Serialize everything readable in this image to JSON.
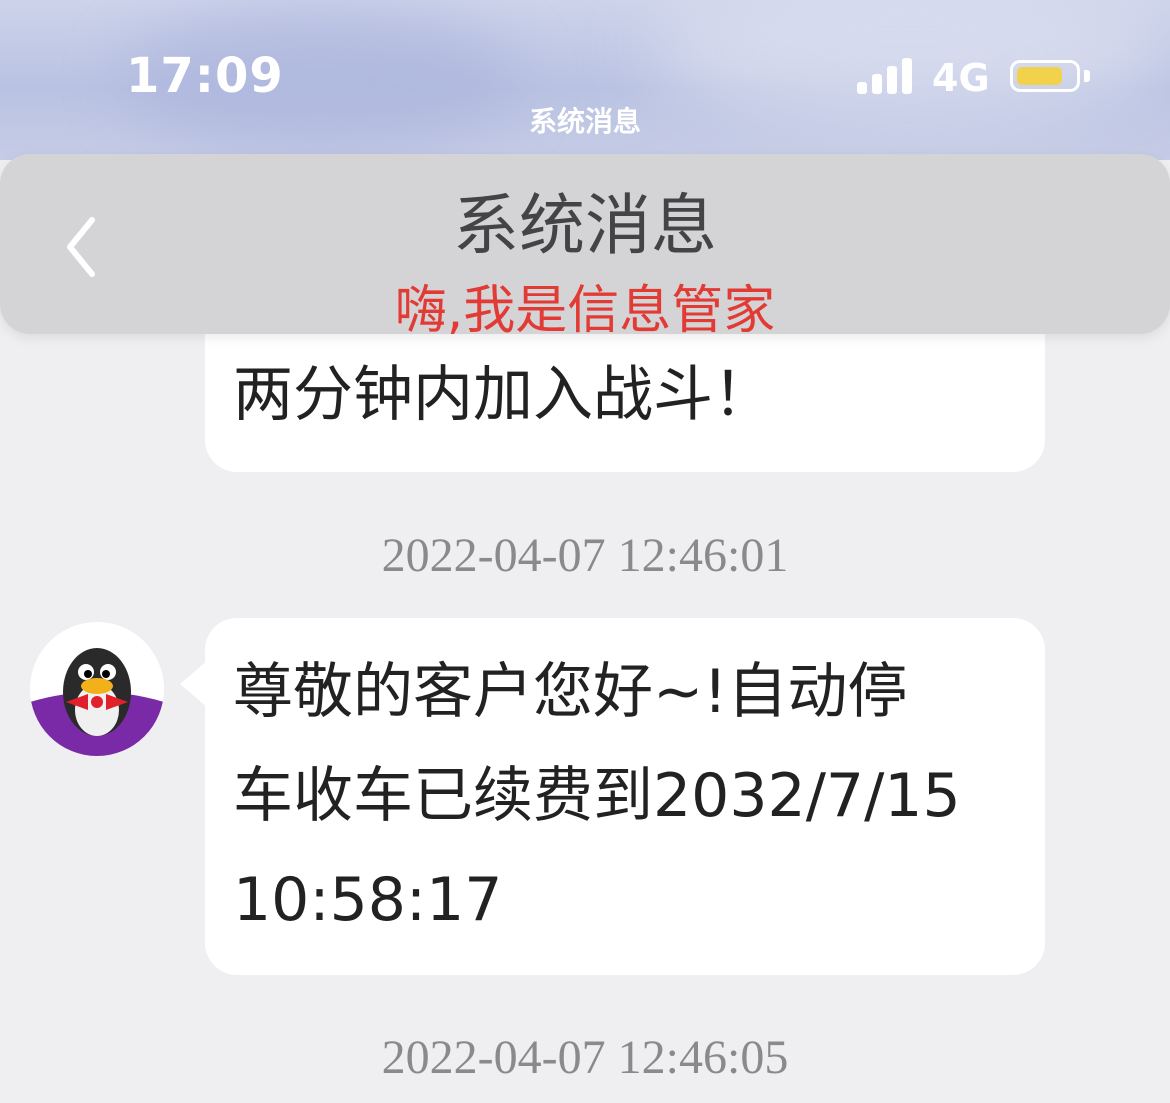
{
  "status_bar": {
    "time": "17:09",
    "app_caption": "系统消息",
    "network": "4G",
    "battery_level": 0.8,
    "battery_color": "#f3d24b"
  },
  "header": {
    "back_icon": "chevron-left-icon",
    "title": "系统消息",
    "subtitle": "嗨,我是信息管家",
    "subtitle_color": "#e23a35"
  },
  "messages": [
    {
      "text": "两分钟内加入战斗！",
      "timestamp": "2022-04-07 12:46:01"
    },
    {
      "avatar_icon": "penguin-avatar-icon",
      "lines": [
        " 尊敬的客户您好~!自动停",
        "车收车已续费到2032/7/15",
        "10:58:17"
      ],
      "timestamp": "2022-04-07 12:46:05"
    }
  ]
}
